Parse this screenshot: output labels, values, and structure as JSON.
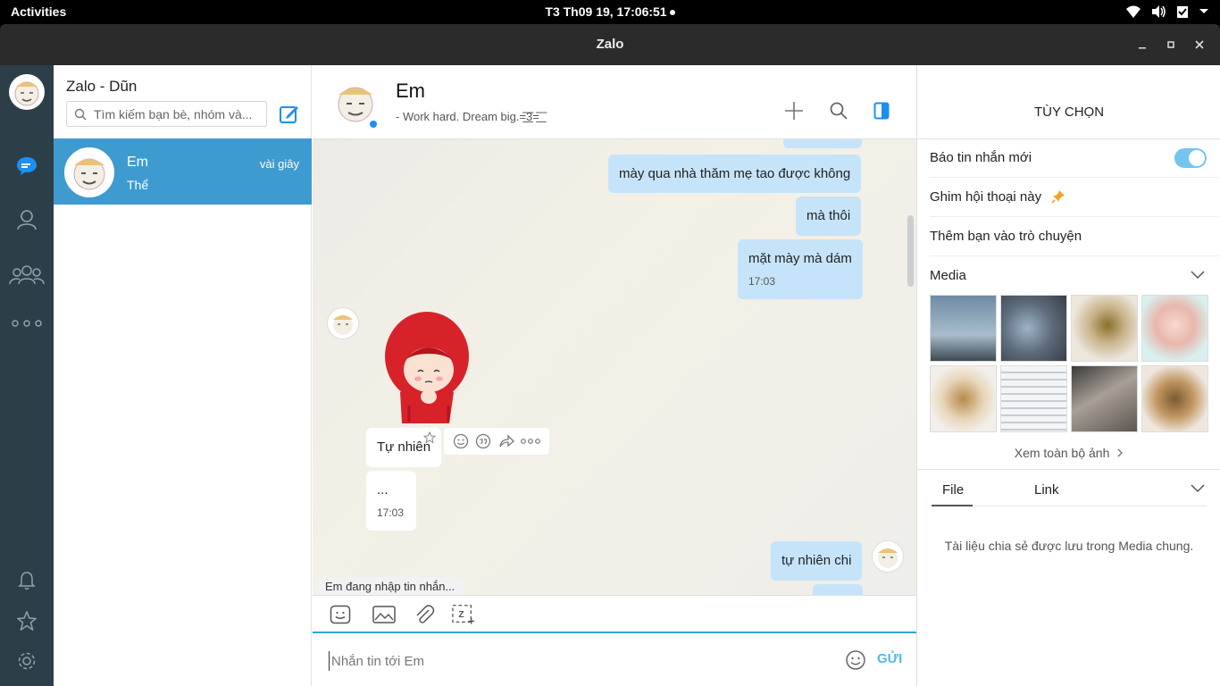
{
  "topbar": {
    "activities": "Activities",
    "clock": "T3 Th09 19, 17:06:51"
  },
  "window": {
    "title": "Zalo"
  },
  "nav": {
    "items": [
      "messages-icon",
      "contacts-icon",
      "groups-icon",
      "more-icon",
      "bell-icon",
      "star-icon",
      "settings-icon"
    ]
  },
  "conversations": {
    "account_name": "Zalo - Dũn",
    "search_placeholder": "Tìm kiếm bạn bè, nhóm và...",
    "items": [
      {
        "name": "Em",
        "time": "vài giây",
        "preview": "Thể"
      }
    ]
  },
  "chat": {
    "contact_name": "Em",
    "status": "- Work hard. Dream big.=͟͟͞͞3=͟͟͞͞",
    "messages": [
      {
        "direction": "out",
        "text": "mày qua nhà thăm mẹ tao được không"
      },
      {
        "direction": "out",
        "text": "mà thôi"
      },
      {
        "direction": "out",
        "text": "mặt mày mà dám",
        "time": "17:03"
      },
      {
        "direction": "in",
        "type": "sticker",
        "sticker": "red-hood-girl-sticker"
      },
      {
        "direction": "in",
        "text": "Tự nhiên"
      },
      {
        "direction": "in",
        "text": "...",
        "time": "17:03"
      },
      {
        "direction": "out",
        "text": "tự nhiên chi"
      }
    ],
    "typing_indicator": "Em đang nhập tin nhắn...",
    "composer_placeholder": "Nhắn tin tới Em",
    "send_label": "GỬI"
  },
  "options": {
    "title": "TÙY CHỌN",
    "rows": {
      "notify": "Báo tin nhắn mới",
      "pin": "Ghim hội thoại này",
      "add_friend": "Thêm bạn vào trò chuyện",
      "media": "Media"
    },
    "notify_enabled": true,
    "see_all": "Xem toàn bộ ảnh",
    "tabs": {
      "file": "File",
      "link": "Link"
    },
    "file_empty": "Tài liệu chia sẻ được lưu trong Media chung."
  },
  "colors": {
    "accent": "#3e9bd0",
    "nav_bg": "#2c3e48",
    "outgoing_bubble": "#c6e4f9",
    "send": "#54b8e8"
  }
}
